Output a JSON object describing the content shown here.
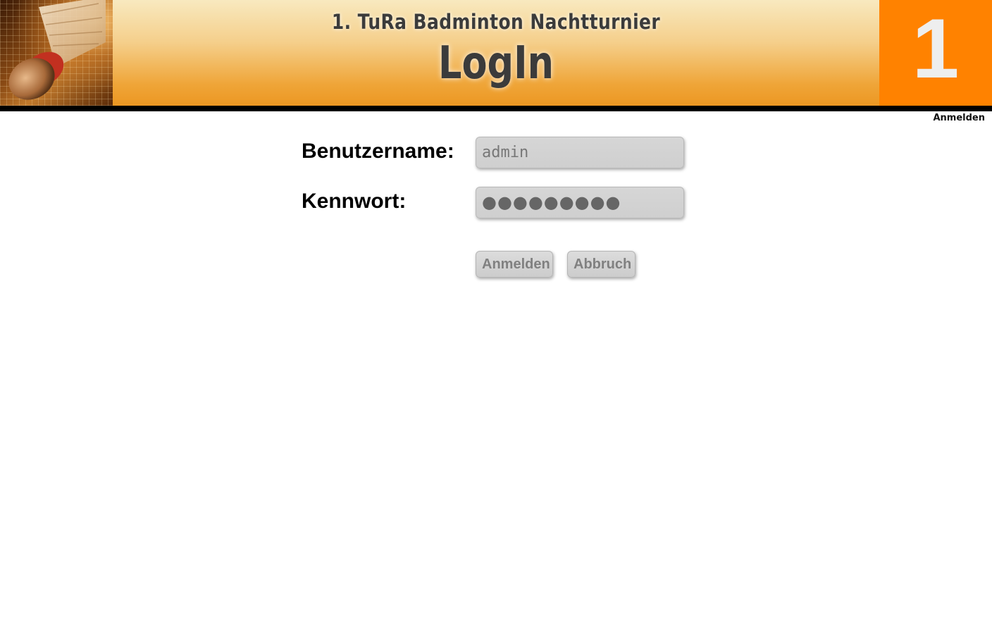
{
  "header": {
    "title": "1. TuRa Badminton Nachtturnier",
    "subtitle": "LogIn",
    "badge_number": "1"
  },
  "nav": {
    "login_link": "Anmelden"
  },
  "form": {
    "username_label": "Benutzername:",
    "username_value": "admin",
    "password_label": "Kennwort:",
    "password_masked": "●●●●●●●●●",
    "submit_label": "Anmelden",
    "cancel_label": "Abbruch"
  },
  "colors": {
    "accent_orange": "#ff8200",
    "header_gradient_top": "#f8e9bf",
    "header_gradient_bottom": "#ec9722",
    "bar": "#000000"
  },
  "icons": {
    "header_image": "badminton-shuttlecock-photo"
  }
}
